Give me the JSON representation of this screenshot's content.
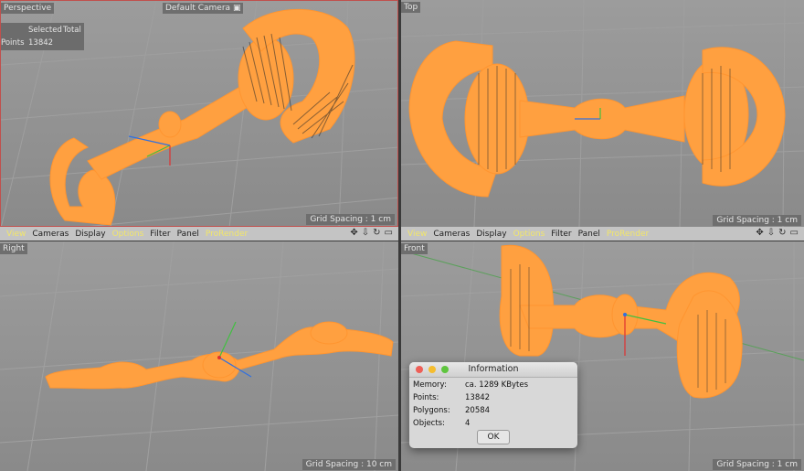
{
  "viewports": {
    "perspective": {
      "label": "Perspective",
      "camera": "Default Camera",
      "grid_spacing": "Grid Spacing : 1 cm",
      "stats": {
        "header_selected": "Selected",
        "header_total": "Total",
        "row_label": "Points",
        "row_value": "13842"
      }
    },
    "top": {
      "label": "Top",
      "grid_spacing": "Grid Spacing : 1 cm"
    },
    "right": {
      "label": "Right",
      "grid_spacing": "Grid Spacing : 10 cm"
    },
    "front": {
      "label": "Front",
      "grid_spacing": "Grid Spacing : 1 cm"
    }
  },
  "menu": {
    "items": [
      "View",
      "Cameras",
      "Display",
      "Options",
      "Filter",
      "Panel",
      "ProRender"
    ],
    "highlighted": [
      "View",
      "Options",
      "ProRender"
    ]
  },
  "nav_icons": [
    "move-icon",
    "dolly-icon",
    "rotate-icon",
    "maximize-icon"
  ],
  "dialog": {
    "title": "Information",
    "rows": [
      {
        "label": "Memory:",
        "value": "ca. 1289 KBytes"
      },
      {
        "label": "Points:",
        "value": "13842"
      },
      {
        "label": "Polygons:",
        "value": "20584"
      },
      {
        "label": "Objects:",
        "value": "4"
      }
    ],
    "ok_label": "OK"
  },
  "colors": {
    "object": "#ffa040",
    "selection_border": "#c0504d",
    "viewport_bg": "#949494",
    "menubar_bg": "#c4c4c4",
    "menu_highlight": "#f2e66a",
    "traffic_red": "#ee5f57",
    "traffic_yellow": "#f5bd2f",
    "traffic_green": "#5fc53e"
  }
}
